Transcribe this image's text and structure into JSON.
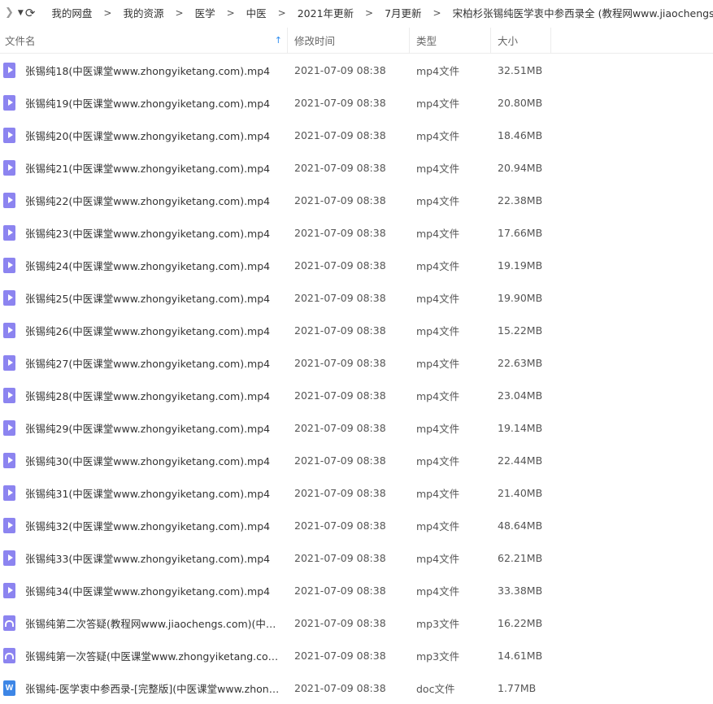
{
  "toolbar": {
    "back_icon": "chevron-right-icon",
    "breadcrumbs": [
      "我的网盘",
      "我的资源",
      "医学",
      "中医",
      "2021年更新",
      "7月更新",
      "宋柏杉张锡纯医学衷中参西录全 (教程网www.jiaochengs.com)"
    ],
    "separator": ">"
  },
  "header": {
    "name": "文件名",
    "date": "修改时间",
    "type": "类型",
    "size": "大小",
    "sort_icon": "arrow-up-icon"
  },
  "accent_color": "#2d8cf0",
  "files": [
    {
      "name": "张锡纯18(中医课堂www.zhongyiketang.com).mp4",
      "date": "2021-07-09 08:38",
      "type": "mp4文件",
      "size": "32.51MB",
      "icon": "mp4"
    },
    {
      "name": "张锡纯19(中医课堂www.zhongyiketang.com).mp4",
      "date": "2021-07-09 08:38",
      "type": "mp4文件",
      "size": "20.80MB",
      "icon": "mp4"
    },
    {
      "name": "张锡纯20(中医课堂www.zhongyiketang.com).mp4",
      "date": "2021-07-09 08:38",
      "type": "mp4文件",
      "size": "18.46MB",
      "icon": "mp4"
    },
    {
      "name": "张锡纯21(中医课堂www.zhongyiketang.com).mp4",
      "date": "2021-07-09 08:38",
      "type": "mp4文件",
      "size": "20.94MB",
      "icon": "mp4"
    },
    {
      "name": "张锡纯22(中医课堂www.zhongyiketang.com).mp4",
      "date": "2021-07-09 08:38",
      "type": "mp4文件",
      "size": "22.38MB",
      "icon": "mp4"
    },
    {
      "name": "张锡纯23(中医课堂www.zhongyiketang.com).mp4",
      "date": "2021-07-09 08:38",
      "type": "mp4文件",
      "size": "17.66MB",
      "icon": "mp4"
    },
    {
      "name": "张锡纯24(中医课堂www.zhongyiketang.com).mp4",
      "date": "2021-07-09 08:38",
      "type": "mp4文件",
      "size": "19.19MB",
      "icon": "mp4"
    },
    {
      "name": "张锡纯25(中医课堂www.zhongyiketang.com).mp4",
      "date": "2021-07-09 08:38",
      "type": "mp4文件",
      "size": "19.90MB",
      "icon": "mp4"
    },
    {
      "name": "张锡纯26(中医课堂www.zhongyiketang.com).mp4",
      "date": "2021-07-09 08:38",
      "type": "mp4文件",
      "size": "15.22MB",
      "icon": "mp4"
    },
    {
      "name": "张锡纯27(中医课堂www.zhongyiketang.com).mp4",
      "date": "2021-07-09 08:38",
      "type": "mp4文件",
      "size": "22.63MB",
      "icon": "mp4"
    },
    {
      "name": "张锡纯28(中医课堂www.zhongyiketang.com).mp4",
      "date": "2021-07-09 08:38",
      "type": "mp4文件",
      "size": "23.04MB",
      "icon": "mp4"
    },
    {
      "name": "张锡纯29(中医课堂www.zhongyiketang.com).mp4",
      "date": "2021-07-09 08:38",
      "type": "mp4文件",
      "size": "19.14MB",
      "icon": "mp4"
    },
    {
      "name": "张锡纯30(中医课堂www.zhongyiketang.com).mp4",
      "date": "2021-07-09 08:38",
      "type": "mp4文件",
      "size": "22.44MB",
      "icon": "mp4"
    },
    {
      "name": "张锡纯31(中医课堂www.zhongyiketang.com).mp4",
      "date": "2021-07-09 08:38",
      "type": "mp4文件",
      "size": "21.40MB",
      "icon": "mp4"
    },
    {
      "name": "张锡纯32(中医课堂www.zhongyiketang.com).mp4",
      "date": "2021-07-09 08:38",
      "type": "mp4文件",
      "size": "48.64MB",
      "icon": "mp4"
    },
    {
      "name": "张锡纯33(中医课堂www.zhongyiketang.com).mp4",
      "date": "2021-07-09 08:38",
      "type": "mp4文件",
      "size": "62.21MB",
      "icon": "mp4"
    },
    {
      "name": "张锡纯34(中医课堂www.zhongyiketang.com).mp4",
      "date": "2021-07-09 08:38",
      "type": "mp4文件",
      "size": "33.38MB",
      "icon": "mp4"
    },
    {
      "name": "张锡纯第二次答疑(教程网www.jiaochengs.com)(中医课...",
      "date": "2021-07-09 08:38",
      "type": "mp3文件",
      "size": "16.22MB",
      "icon": "mp3"
    },
    {
      "name": "张锡纯第一次答疑(中医课堂www.zhongyiketang.com)....",
      "date": "2021-07-09 08:38",
      "type": "mp3文件",
      "size": "14.61MB",
      "icon": "mp3"
    },
    {
      "name": "张锡纯-医学衷中参西录-[完整版](中医课堂www.zhongyi...",
      "date": "2021-07-09 08:38",
      "type": "doc文件",
      "size": "1.77MB",
      "icon": "doc"
    }
  ]
}
